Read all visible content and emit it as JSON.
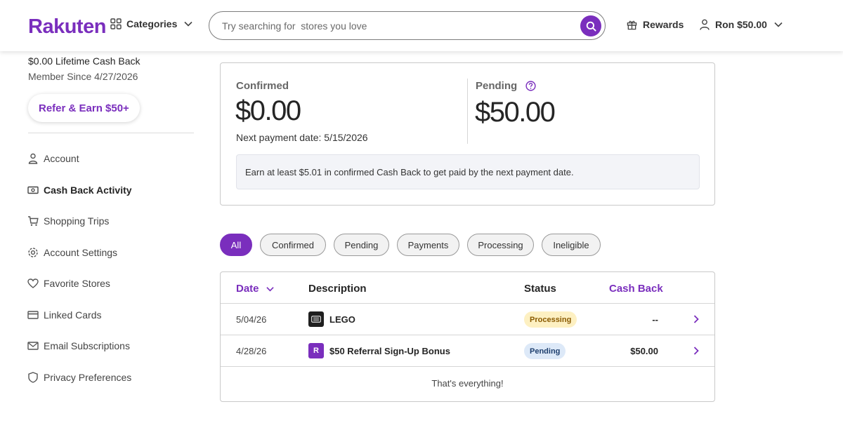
{
  "header": {
    "logo": "Rakuten",
    "categories_label": "Categories",
    "search_placeholder": "Try searching for  stores you love",
    "rewards_label": "Rewards",
    "user_label": "Ron $50.00"
  },
  "sidebar": {
    "lifetime": "$0.00 Lifetime Cash Back",
    "member_since": "Member Since 4/27/2026",
    "refer_label": "Refer & Earn $50+",
    "items": [
      {
        "label": "Account",
        "icon": "person-icon",
        "active": false
      },
      {
        "label": "Cash Back Activity",
        "icon": "cash-icon",
        "active": true
      },
      {
        "label": "Shopping Trips",
        "icon": "cart-icon",
        "active": false
      },
      {
        "label": "Account Settings",
        "icon": "gear-icon",
        "active": false
      },
      {
        "label": "Favorite Stores",
        "icon": "heart-icon",
        "active": false
      },
      {
        "label": "Linked Cards",
        "icon": "card-icon",
        "active": false
      },
      {
        "label": "Email Subscriptions",
        "icon": "mail-icon",
        "active": false
      },
      {
        "label": "Privacy Preferences",
        "icon": "shield-icon",
        "active": false
      }
    ]
  },
  "summary": {
    "confirmed_label": "Confirmed",
    "confirmed_amount": "$0.00",
    "next_payment": "Next payment date:  5/15/2026",
    "pending_label": "Pending",
    "pending_amount": "$50.00",
    "info": "Earn at least $5.01 in confirmed Cash Back to get paid by the next payment date."
  },
  "filters": [
    "All",
    "Confirmed",
    "Pending",
    "Payments",
    "Processing",
    "Ineligible"
  ],
  "table": {
    "headers": {
      "date": "Date",
      "description": "Description",
      "status": "Status",
      "cash_back": "Cash Back"
    },
    "rows": [
      {
        "date": "5/04/26",
        "description": "LEGO",
        "status": "Processing",
        "cash_back": "--"
      },
      {
        "date": "4/28/26",
        "description": "$50 Referral Sign-Up Bonus",
        "status": "Pending",
        "cash_back": "$50.00"
      }
    ],
    "footer": "That's everything!"
  },
  "colors": {
    "brand": "#7a2ebd",
    "processing_bg": "#fdf0c2",
    "pending_bg": "#dde9f8"
  }
}
